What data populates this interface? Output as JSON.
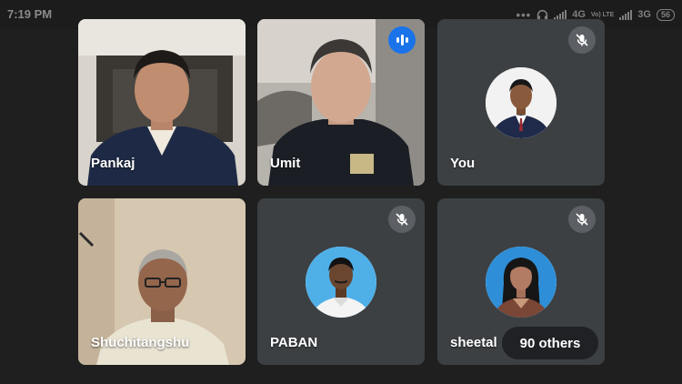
{
  "status_bar": {
    "time": "7:19 PM",
    "network_4g": "4G",
    "volte": "Vo) LTE",
    "network_3g": "3G",
    "battery": "56",
    "icons": [
      "more-dots-icon",
      "headset-icon",
      "signal-icon",
      "signal-icon",
      "battery-icon"
    ]
  },
  "participants": [
    {
      "name": "Pankaj",
      "state": "video"
    },
    {
      "name": "Umit",
      "state": "video-speaking",
      "icon": "speaking-indicator-icon"
    },
    {
      "name": "You",
      "state": "avatar",
      "icon": "mic-off-icon"
    },
    {
      "name": "Shuchitangshu",
      "state": "video"
    },
    {
      "name": "PABAN",
      "state": "avatar",
      "icon": "mic-off-icon"
    },
    {
      "name": "sheetal",
      "state": "avatar",
      "icon": "mic-off-icon"
    }
  ],
  "others": {
    "label": "90 others"
  },
  "colors": {
    "background": "#1f1f1f",
    "tile": "#3c4043",
    "speaking_indicator": "#1a73e8",
    "mic_off_badge": "#5c5f63"
  }
}
